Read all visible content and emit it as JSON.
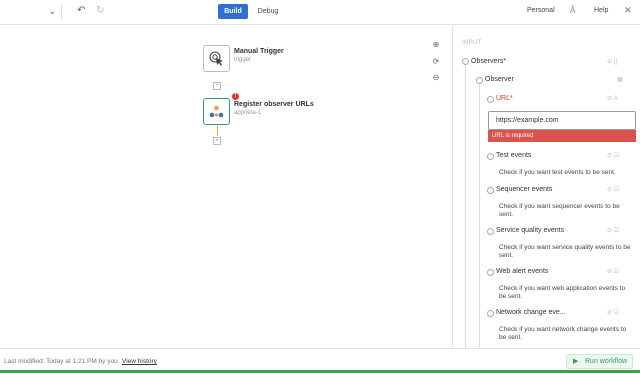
{
  "toolbar": {
    "select_chevron": "⌄",
    "undo_icon": "↶",
    "redo_icon": "↻",
    "build_label": "Build",
    "debug_label": "Debug",
    "workspace_label": "Personal",
    "help_icon": "Å",
    "help_label": "Help",
    "close_icon": "✕"
  },
  "canvas": {
    "nodes": [
      {
        "title": "Manual Trigger",
        "subtitle": "trigger"
      },
      {
        "title": "Register observer URLs",
        "subtitle": "appneta-1",
        "error_badge": "!"
      }
    ],
    "plus_glyph": "+",
    "zoom_in": "⊕",
    "refresh": "⟳",
    "zoom_out": "⊖"
  },
  "panel": {
    "header": "INPUT",
    "observers_label": "Observers*",
    "observers_icons": "⊘ {}",
    "observer_label": "Observer",
    "observer_icon": "▦",
    "url_label": "URL*",
    "url_icons": "⊘ A",
    "url_value": "https://example.com",
    "url_error": "URL is required",
    "fields": [
      {
        "label": "Test events",
        "desc": "Check if you want test events to be sent."
      },
      {
        "label": "Sequencer events",
        "desc": "Check if you want sequencer events to be sent."
      },
      {
        "label": "Service quality events",
        "desc": "Check if you want service quality events to be sent."
      },
      {
        "label": "Web alert events",
        "desc": "Check if you want web application events to be sent."
      },
      {
        "label": "Network change eve...",
        "desc": "Check if you want network change events to be sent."
      }
    ],
    "field_icons": "⊘ ☑"
  },
  "footer": {
    "status": "Last modified: Today at 1:21 PM by you",
    "history_link": "View history",
    "run_icon": "▶",
    "run_label": "Run workflow"
  },
  "colors": {
    "primary": "#2f6fd4",
    "accent": "#2f9e5f",
    "error": "#d9534f"
  }
}
